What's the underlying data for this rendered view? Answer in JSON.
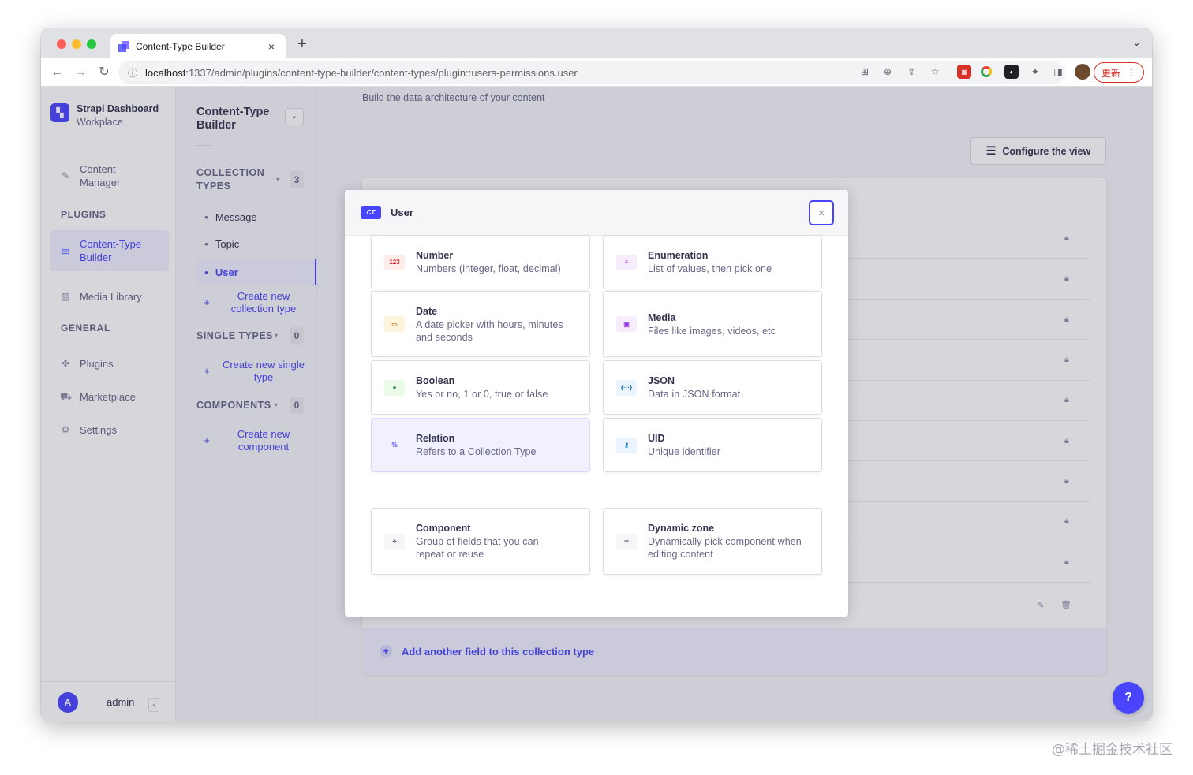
{
  "browser": {
    "tab_title": "Content-Type Builder",
    "url_host": "localhost",
    "url_rest": ":1337/admin/plugins/content-type-builder/content-types/plugin::users-permissions.user",
    "update_label": "更新"
  },
  "sidebar": {
    "brand_name": "Strapi Dashboard",
    "brand_workspace": "Workplace",
    "content_manager": "Content\nManager",
    "plugins_heading": "PLUGINS",
    "content_type_builder": "Content-Type\nBuilder",
    "media_library": "Media Library",
    "general_heading": "GENERAL",
    "plugins": "Plugins",
    "marketplace": "Marketplace",
    "settings": "Settings",
    "avatar_initial": "A",
    "user_name": "admin"
  },
  "subnav": {
    "title": "Content-Type\nBuilder",
    "collection_types": "COLLECTION\nTYPES",
    "collection_count": "3",
    "items": [
      "Message",
      "Topic",
      "User"
    ],
    "create_collection": "Create new\ncollection type",
    "single_types": "SINGLE TYPES",
    "single_count": "0",
    "create_single": "Create new single\ntype",
    "components": "COMPONENTS",
    "components_count": "0",
    "create_component": "Create new\ncomponent"
  },
  "main": {
    "subtitle": "Build the data architecture of your content",
    "configure_view": "Configure the view",
    "add_field": "Add another field to this collection type"
  },
  "modal": {
    "badge": "CT",
    "title": "User",
    "cards": [
      {
        "title": "Number",
        "desc": "Numbers (integer, float, decimal)",
        "icon": "123",
        "icon_name": "number-icon",
        "icon_bg": "#fcecea",
        "icon_color": "#d02b20"
      },
      {
        "title": "Enumeration",
        "desc": "List of values, then pick one",
        "icon": "≡",
        "icon_name": "enumeration-icon",
        "icon_bg": "#f6ecfc",
        "icon_color": "#9736e8"
      },
      {
        "title": "Date",
        "desc": "A date picker with hours, minutes\nand seconds",
        "icon": "▭",
        "icon_name": "date-icon",
        "icon_bg": "#fdf4dc",
        "icon_color": "#d9822f"
      },
      {
        "title": "Media",
        "desc": "Files like images, videos, etc",
        "icon": "▣",
        "icon_name": "media-icon",
        "icon_bg": "#f6ecfc",
        "icon_color": "#9736e8"
      },
      {
        "title": "Boolean",
        "desc": "Yes or no, 1 or 0, true or false",
        "icon": "●",
        "icon_name": "boolean-icon",
        "icon_bg": "#eafbe7",
        "icon_color": "#328048"
      },
      {
        "title": "JSON",
        "desc": "Data in JSON format",
        "icon": "{···}",
        "icon_name": "json-icon",
        "icon_bg": "#eaf5ff",
        "icon_color": "#0c75af"
      },
      {
        "title": "Relation",
        "desc": "Refers to a Collection Type",
        "icon": "%",
        "icon_name": "relation-icon",
        "icon_bg": "#f0f0ff",
        "icon_color": "#4945ff"
      },
      {
        "title": "UID",
        "desc": "Unique identifier",
        "icon": "⚷",
        "icon_name": "uid-icon",
        "icon_bg": "#eaf5ff",
        "icon_color": "#0c75af"
      },
      {
        "title": "Component",
        "desc": "Group of fields that you can\nrepeat or reuse",
        "icon": "⟡",
        "icon_name": "component-icon",
        "icon_bg": "#f6f6f9",
        "icon_color": "#32324d"
      },
      {
        "title": "Dynamic zone",
        "desc": "Dynamically pick component when\nediting content",
        "icon": "∞",
        "icon_name": "dynamic-zone-icon",
        "icon_bg": "#f6f6f9",
        "icon_color": "#32324d"
      }
    ]
  },
  "help": "?",
  "watermark": "@稀土掘金技术社区"
}
